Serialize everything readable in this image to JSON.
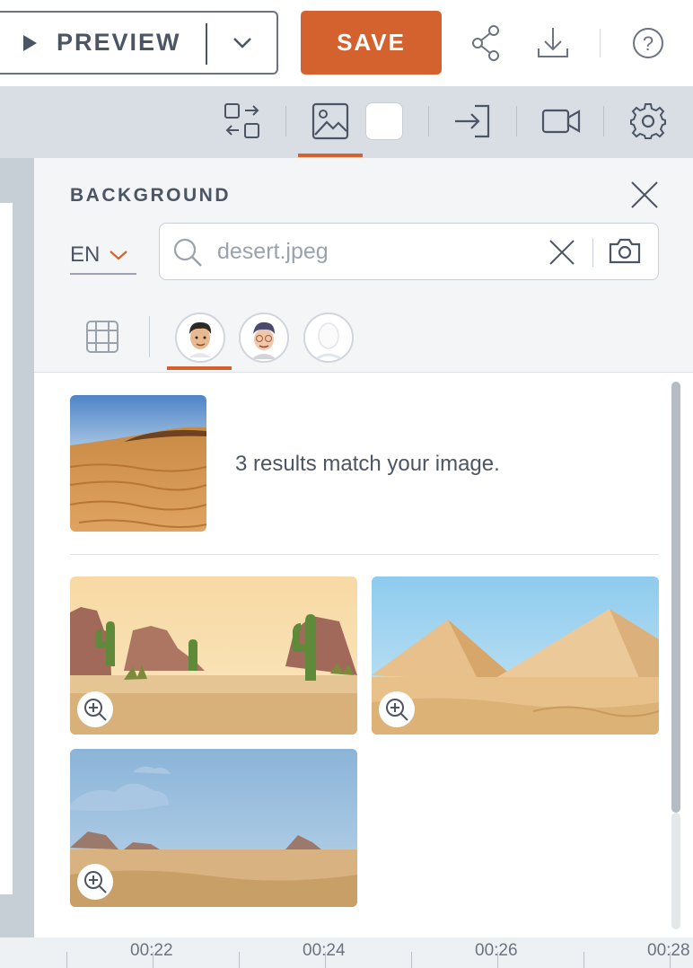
{
  "topbar": {
    "preview_label": "PREVIEW",
    "save_label": "SAVE"
  },
  "panel": {
    "title": "BACKGROUND",
    "language": "EN",
    "search": {
      "value": "",
      "placeholder": "desert.jpeg"
    },
    "match_text": "3 results match your image."
  },
  "timeline": {
    "labels": [
      "00:22",
      "00:24",
      "00:26",
      "00:28"
    ]
  },
  "colors": {
    "accent": "#d4622e",
    "text": "#4b5563"
  }
}
